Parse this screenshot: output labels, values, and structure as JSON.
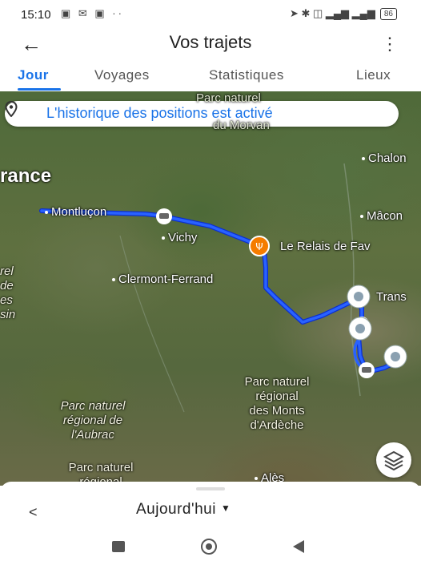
{
  "status_bar": {
    "time": "15:10",
    "left_icons": "▣ ✉ ▣ ··",
    "right_icons": "➤ ✱ ◫ ▂▄▆ ▂▄▆",
    "battery": "86"
  },
  "app_bar": {
    "back_icon": "arrow-left-icon",
    "title": "Vos trajets",
    "menu_icon": "more-vert-icon"
  },
  "tabs": [
    {
      "label": "Jour",
      "active": true
    },
    {
      "label": "Voyages",
      "active": false
    },
    {
      "label": "Statistiques",
      "active": false
    },
    {
      "label": "Lieux",
      "active": false
    }
  ],
  "map": {
    "history_banner": "L'historique des positions est activé",
    "labels": {
      "region_top": "Parc naturel",
      "region_top2": "du Morvan",
      "france": "rance",
      "montlucon": "Montluçon",
      "vichy": "Vichy",
      "clermont": "Clermont-Ferrand",
      "relais": "Le Relais de Fav",
      "chalon": "Chalon",
      "macon": "Mâcon",
      "trans": "Trans",
      "ardeche": [
        "Parc naturel",
        "régional",
        "des Monts",
        "d'Ardèche"
      ],
      "aubrac": [
        "Parc naturel",
        "régional de",
        "l'Aubrac"
      ],
      "bottom_park": "Parc naturel",
      "bottom_park2": "régional",
      "ales": "Alès",
      "left_edge": [
        "rel",
        "de",
        "es",
        "sin"
      ]
    },
    "route_color": "#2962ff",
    "marker_color": "#f57c00"
  },
  "bottom_sheet": {
    "prev_icon": "chevron-left-icon",
    "selected_day": "Aujourd'hui"
  }
}
